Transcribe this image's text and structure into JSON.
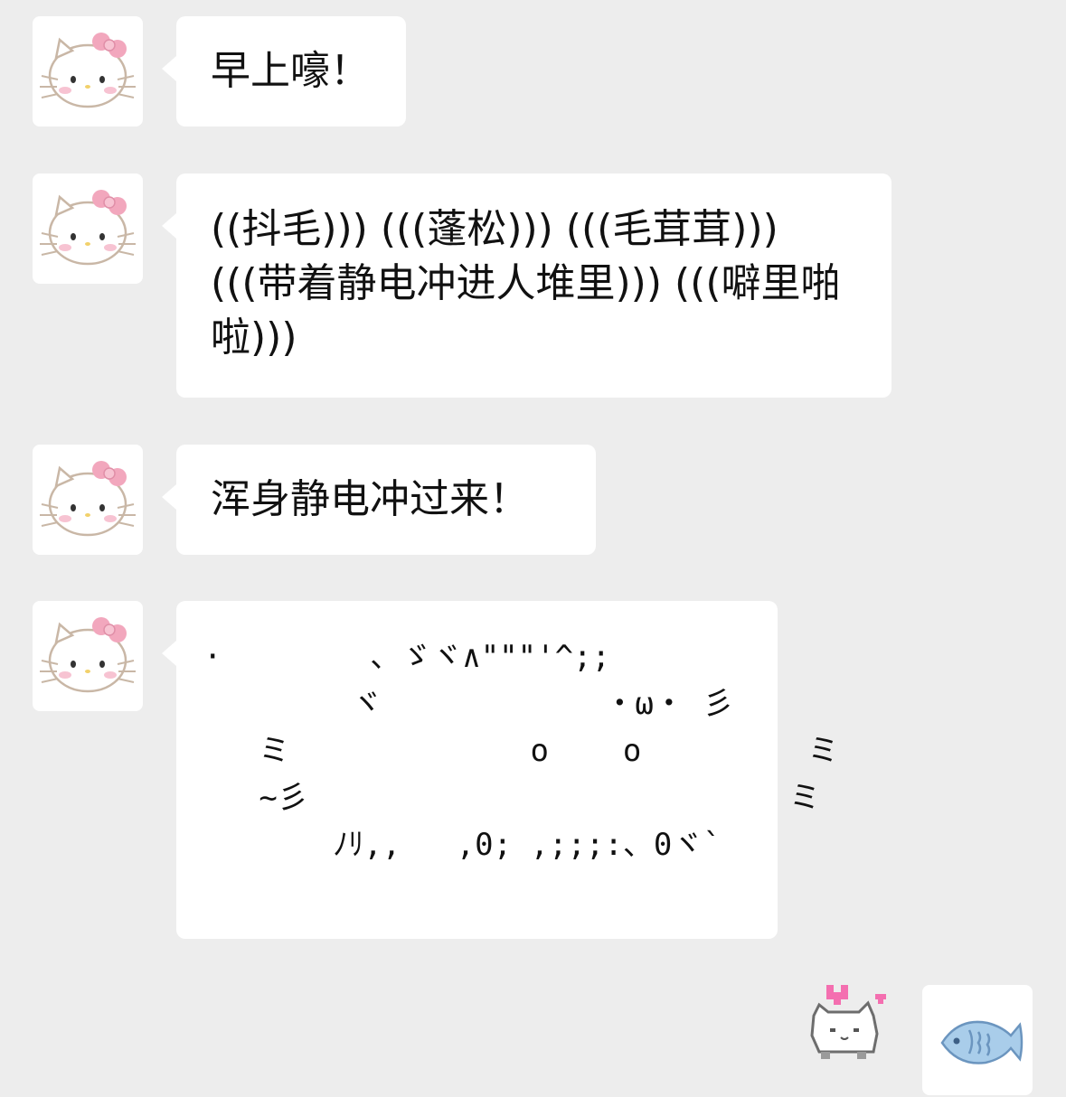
{
  "colors": {
    "background": "#ededed",
    "bubble": "#ffffff",
    "bow": "#f2a7bd",
    "fish": "#a9cdea"
  },
  "messages": [
    {
      "sender": "other",
      "avatar_icon": "hello-kitty-icon",
      "text": "早上嚎！"
    },
    {
      "sender": "other",
      "avatar_icon": "hello-kitty-icon",
      "text": "((抖毛))) (((蓬松))) (((毛茸茸))) (((带着静电冲进人堆里))) (((噼里啪啦)))"
    },
    {
      "sender": "other",
      "avatar_icon": "hello-kitty-icon",
      "text": "浑身静电冲过来！"
    },
    {
      "sender": "other",
      "avatar_icon": "hello-kitty-icon",
      "text": "·        、ゞヾ∧\"\"\"'^;;\n        ヾ            ・ω・ 彡\n   ミ             o    o         ミ\n   ~彡                          ミ\n       ﾉﾘ,,   ,0; ,;;;:、0ヾ`"
    }
  ],
  "my_avatar_icon": "fish-icon",
  "sticker_icon": "pixel-cat-heart-icon"
}
